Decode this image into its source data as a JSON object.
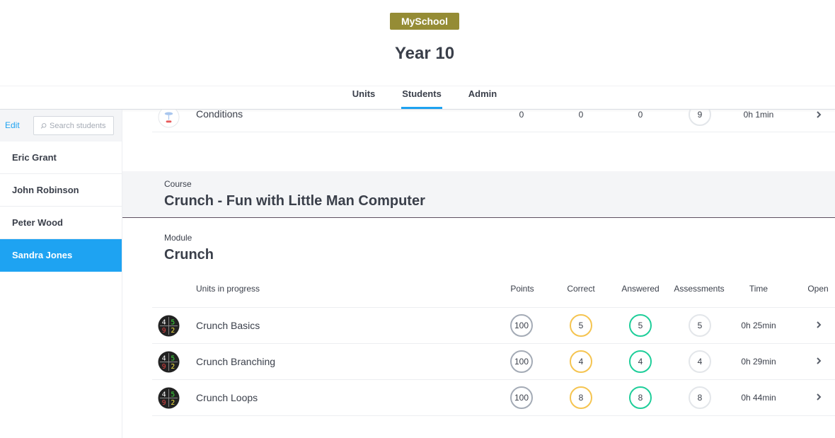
{
  "header": {
    "school": "MySchool",
    "title": "Year 10",
    "tabs": [
      {
        "label": "Units"
      },
      {
        "label": "Students",
        "active": true
      },
      {
        "label": "Admin"
      }
    ],
    "accent_color": "#1ea3f2",
    "badge_color": "#958c35"
  },
  "sidebar": {
    "edit_label": "Edit",
    "search_placeholder": "Search students",
    "students": [
      {
        "name": "Eric Grant"
      },
      {
        "name": "John Robinson"
      },
      {
        "name": "Peter Wood"
      },
      {
        "name": "Sandra Jones",
        "selected": true
      }
    ]
  },
  "previous_row": {
    "name": "Conditions",
    "points": "0",
    "correct": "0",
    "answered": "0",
    "assessments": "9",
    "time": "0h 1min"
  },
  "course": {
    "label": "Course",
    "title": "Crunch - Fun with Little Man Computer"
  },
  "module": {
    "label": "Module",
    "title": "Crunch"
  },
  "table": {
    "headers": {
      "units": "Units in progress",
      "points": "Points",
      "correct": "Correct",
      "answered": "Answered",
      "assessments": "Assessments",
      "time": "Time",
      "open": "Open"
    },
    "rows": [
      {
        "name": "Crunch Basics",
        "points": "100",
        "correct": "5",
        "answered": "5",
        "assessments": "5",
        "time": "0h 25min"
      },
      {
        "name": "Crunch Branching",
        "points": "100",
        "correct": "4",
        "answered": "4",
        "assessments": "4",
        "time": "0h 29min"
      },
      {
        "name": "Crunch Loops",
        "points": "100",
        "correct": "8",
        "answered": "8",
        "assessments": "8",
        "time": "0h 44min"
      }
    ],
    "colors": {
      "points": "#a4abb6",
      "correct": "#f5c450",
      "answered": "#1fce9a",
      "assessments": "#e3e6ea"
    }
  }
}
